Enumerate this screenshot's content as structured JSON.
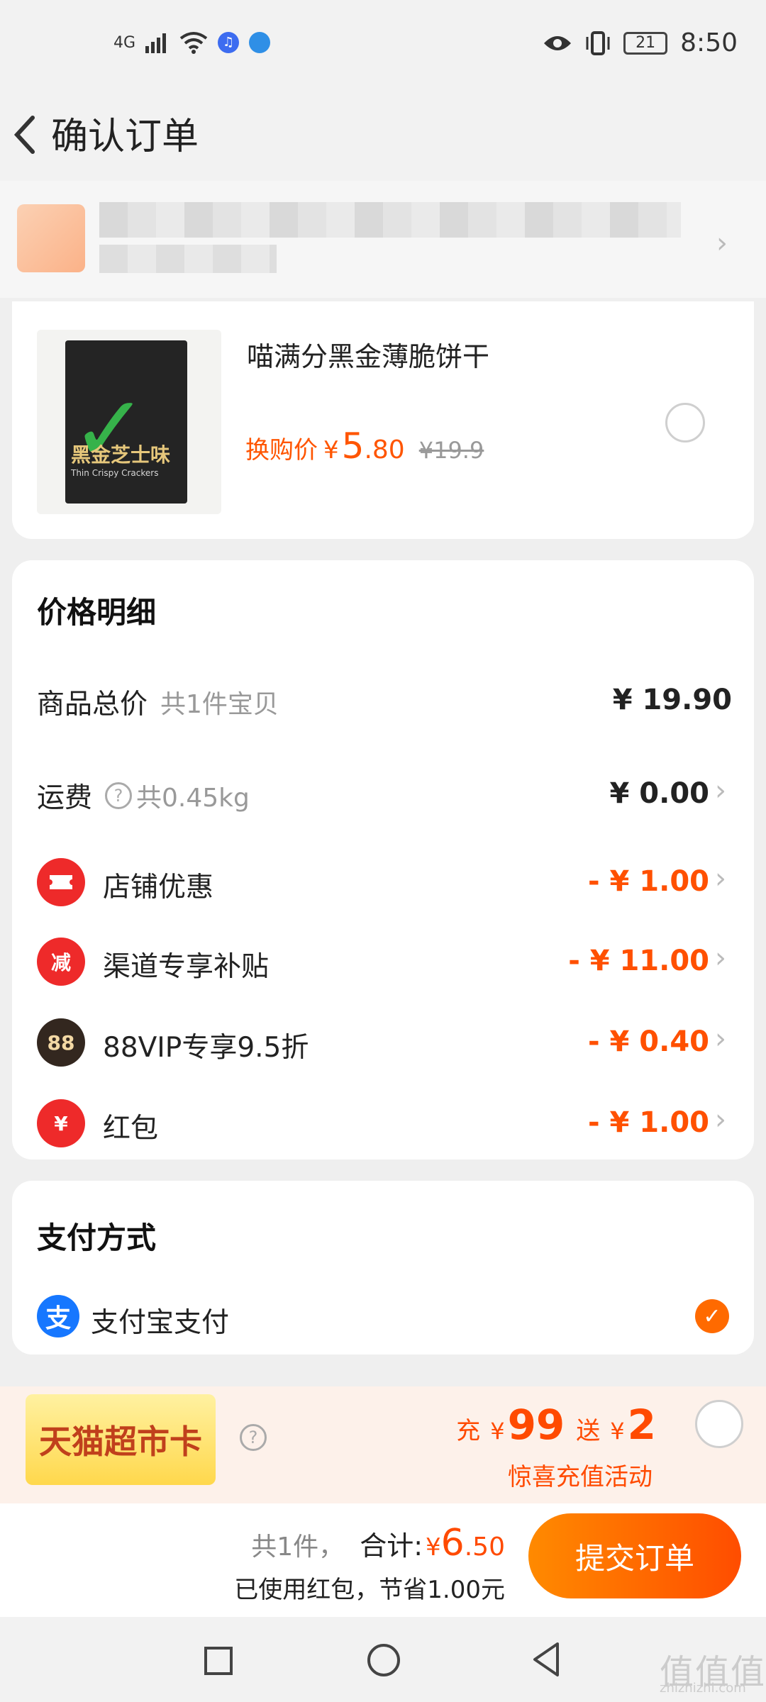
{
  "status_bar": {
    "network": "4G",
    "time": "8:50",
    "battery": "21"
  },
  "header": {
    "title": "确认订单"
  },
  "product": {
    "name": "喵满分黑金薄脆饼干",
    "price_label": "换购价",
    "currency": "¥",
    "price_int": "5",
    "price_dec": ".80",
    "original_price": "¥19.9",
    "package_title": "黑金芝士味",
    "package_sub": "Thin Crispy Crackers"
  },
  "price_detail": {
    "title": "价格明细",
    "rows": [
      {
        "label": "商品总价",
        "sub": "共1件宝贝",
        "value": "¥ 19.90"
      },
      {
        "label": "运费",
        "sub": "共0.45kg",
        "value": "¥ 0.00"
      },
      {
        "label": "店铺优惠",
        "value": "- ¥ 1.00"
      },
      {
        "label": "渠道专享补贴",
        "icon_text": "减",
        "value": "- ¥ 11.00"
      },
      {
        "label": "88VIP专享9.5折",
        "icon_text": "88",
        "value": "- ¥ 0.40"
      },
      {
        "label": "红包",
        "icon_text": "¥",
        "value": "- ¥ 1.00"
      }
    ]
  },
  "payment": {
    "title": "支付方式",
    "method": "支付宝支付",
    "icon_text": "支"
  },
  "promo": {
    "badge": "天猫超市卡",
    "charge_label": "充",
    "charge_amount": "99",
    "gift_label": "送",
    "gift_amount": "2",
    "currency": "¥",
    "subtitle": "惊喜充值活动"
  },
  "summary": {
    "count": "共1件，",
    "total_label": "合计:",
    "currency": "¥",
    "total_int": "6",
    "total_dec": ".50",
    "savings_note": "已使用红包，节省1.00元",
    "submit_label": "提交订单"
  },
  "watermark": {
    "text": "值值值",
    "url": "zhizhizhi.com"
  },
  "colors": {
    "accent": "#ff5000",
    "alipay": "#1677ff",
    "red_icon": "#ee2a2a"
  }
}
